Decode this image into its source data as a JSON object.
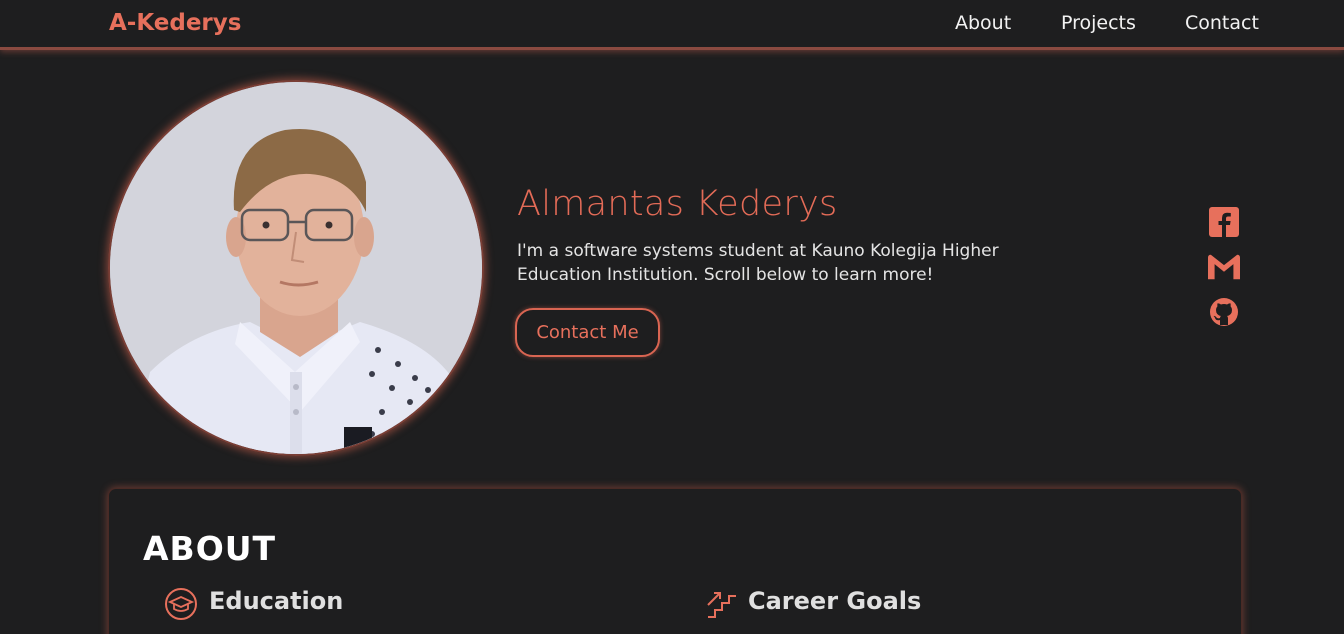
{
  "nav": {
    "brand": "A-Kederys",
    "links": [
      "About",
      "Projects",
      "Contact"
    ]
  },
  "hero": {
    "name": "Almantas Kederys",
    "intro": "I'm a software systems student at Kauno Kolegija Higher Education Institution. Scroll below to learn more!",
    "contact_button": "Contact Me"
  },
  "social": [
    "facebook-icon",
    "gmail-icon",
    "github-icon"
  ],
  "about": {
    "title": "ABOUT",
    "sections": [
      {
        "heading": "Education",
        "icon": "graduation-cap-icon"
      },
      {
        "heading": "Career Goals",
        "icon": "stairs-icon"
      }
    ]
  },
  "colors": {
    "background": "#1e1e1f",
    "accent": "#e7705c",
    "text": "#e8e8e8"
  }
}
